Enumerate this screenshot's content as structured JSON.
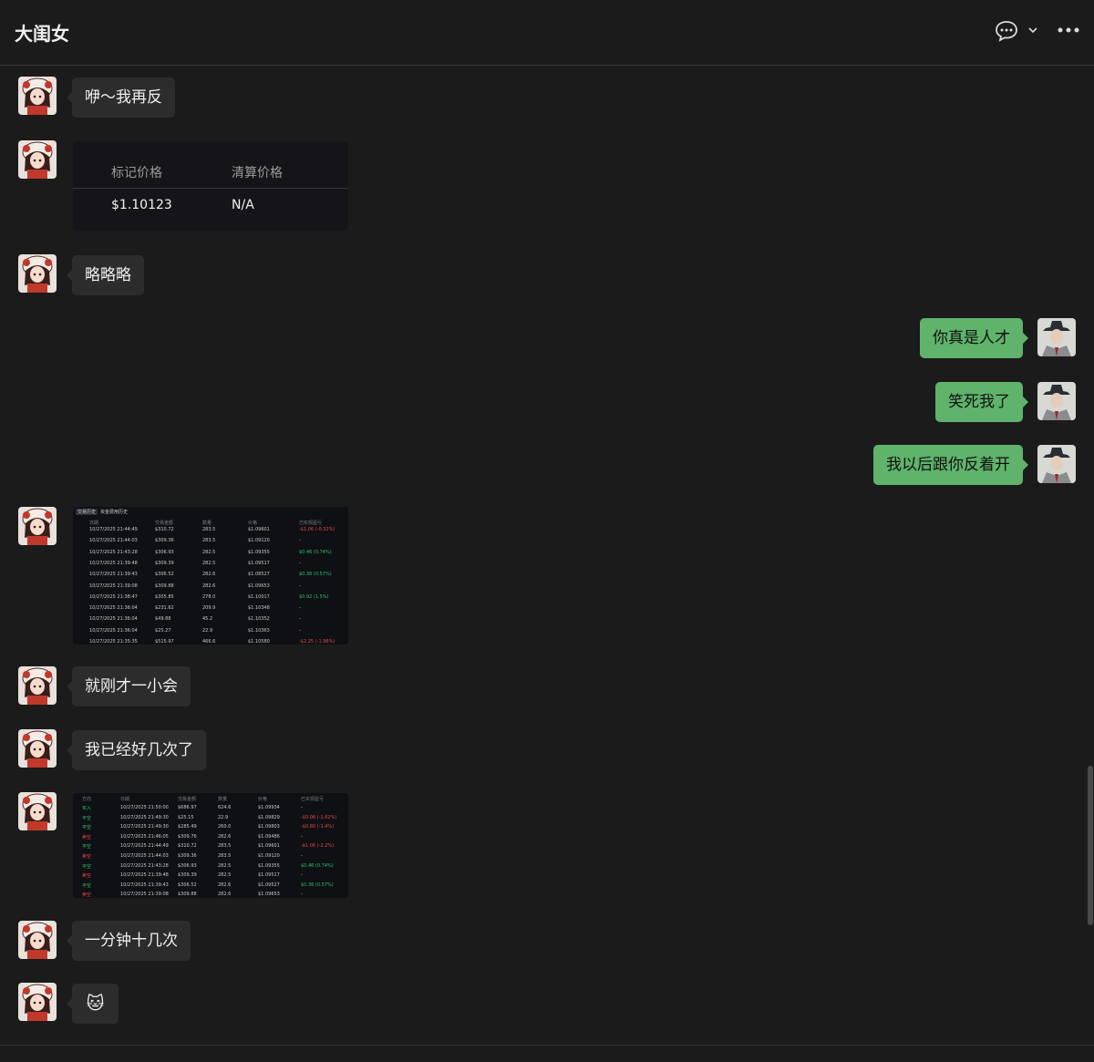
{
  "chat": {
    "title": "大闺女"
  },
  "header_icons": [
    "speech-bubble-icon",
    "chevron-down-icon",
    "more-icon"
  ],
  "messages": [
    {
      "side": "left",
      "type": "text",
      "text": "咿～我再反"
    },
    {
      "side": "left",
      "type": "card",
      "headers": [
        "标记价格",
        "清算价格"
      ],
      "values": [
        "$1.10123",
        "N/A"
      ]
    },
    {
      "side": "left",
      "type": "text",
      "text": "略略略"
    },
    {
      "side": "right",
      "type": "text",
      "text": "你真是人才"
    },
    {
      "side": "right",
      "type": "text",
      "text": "笑死我了"
    },
    {
      "side": "right",
      "type": "text",
      "text": "我以后跟你反着开"
    },
    {
      "side": "left",
      "type": "image",
      "tabs": [
        "交易历史",
        "资金费用历史"
      ],
      "headers": [
        "日期",
        "交易金额",
        "数量",
        "价格",
        "已实现盈亏"
      ],
      "rows": [
        [
          "10/27/2025 21:44:49",
          "$310.72",
          "283.5",
          "$1.09601",
          "-$1.06 (-0.32%)",
          "r"
        ],
        [
          "10/27/2025 21:44:03",
          "$309.36",
          "283.5",
          "$1.09120",
          "-",
          ""
        ],
        [
          "10/27/2025 21:43:28",
          "$306.93",
          "282.5",
          "$1.09355",
          "$0.46 (0.74%)",
          "g"
        ],
        [
          "10/27/2025 21:39:48",
          "$309.39",
          "282.5",
          "$1.09517",
          "-",
          ""
        ],
        [
          "10/27/2025 21:39:43",
          "$306.52",
          "282.6",
          "$1.08527",
          "$0.36 (0.57%)",
          "g"
        ],
        [
          "10/27/2025 21:39:08",
          "$309.88",
          "282.6",
          "$1.09653",
          "-",
          ""
        ],
        [
          "10/27/2025 21:38:47",
          "$305.85",
          "278.0",
          "$1.10017",
          "$0.92 (1.5%)",
          "g"
        ],
        [
          "10/27/2025 21:36:04",
          "$231.62",
          "209.9",
          "$1.10348",
          "-",
          ""
        ],
        [
          "10/27/2025 21:36:04",
          "$49.88",
          "45.2",
          "$1.10352",
          "-",
          ""
        ],
        [
          "10/27/2025 21:36:04",
          "$25.27",
          "22.9",
          "$1.10363",
          "-",
          ""
        ],
        [
          "10/27/2025 21:35:35",
          "$515.97",
          "466.6",
          "$1.10580",
          "-$2.25 (-1.96%)",
          "r"
        ]
      ]
    },
    {
      "side": "left",
      "type": "text",
      "text": "就刚才一小会"
    },
    {
      "side": "left",
      "type": "text",
      "text": "我已经好几次了"
    },
    {
      "side": "left",
      "type": "image",
      "headers": [
        "方向",
        "日期",
        "交易金额",
        "数量",
        "价格",
        "已实现盈亏"
      ],
      "rows": [
        [
          "买入",
          "10/27/2025 21:50:00",
          "$686.97",
          "624.6",
          "$1.09934",
          "-",
          "",
          "g"
        ],
        [
          "平空",
          "10/27/2025 21:49:30",
          "$25.15",
          "22.9",
          "$1.09829",
          "-$0.06 (-1.62%)",
          "r",
          "g"
        ],
        [
          "平空",
          "10/27/2025 21:49:30",
          "$285.49",
          "260.0",
          "$1.09803",
          "-$0.80 (-1.4%)",
          "r",
          "g"
        ],
        [
          "卖空",
          "10/27/2025 21:46:05",
          "$309.76",
          "282.6",
          "$1.09486",
          "-",
          "",
          "r"
        ],
        [
          "平空",
          "10/27/2025 21:44:49",
          "$310.72",
          "283.5",
          "$1.09601",
          "-$1.06 (-2.2%)",
          "r",
          "g"
        ],
        [
          "卖空",
          "10/27/2025 21:44:03",
          "$309.36",
          "283.5",
          "$1.09120",
          "-",
          "",
          "r"
        ],
        [
          "平空",
          "10/27/2025 21:43:28",
          "$306.93",
          "282.5",
          "$1.09355",
          "$0.46 (0.74%)",
          "g",
          "g"
        ],
        [
          "卖空",
          "10/27/2025 21:39:48",
          "$309.39",
          "282.5",
          "$1.09517",
          "-",
          "",
          "r"
        ],
        [
          "平空",
          "10/27/2025 21:39:43",
          "$306.52",
          "282.6",
          "$1.09527",
          "$0.36 (0.57%)",
          "g",
          "g"
        ],
        [
          "卖空",
          "10/27/2025 21:39:08",
          "$309.88",
          "282.6",
          "$1.09653",
          "-",
          "",
          "r"
        ]
      ]
    },
    {
      "side": "left",
      "type": "text",
      "text": "一分钟十几次"
    },
    {
      "side": "left",
      "type": "text",
      "text": "🐱"
    }
  ],
  "colors": {
    "background": "#1b1b1b",
    "left_bubble": "#2c2c2c",
    "right_bubble": "#5fb36b",
    "gain": "#32c06f",
    "loss": "#e5484d"
  }
}
